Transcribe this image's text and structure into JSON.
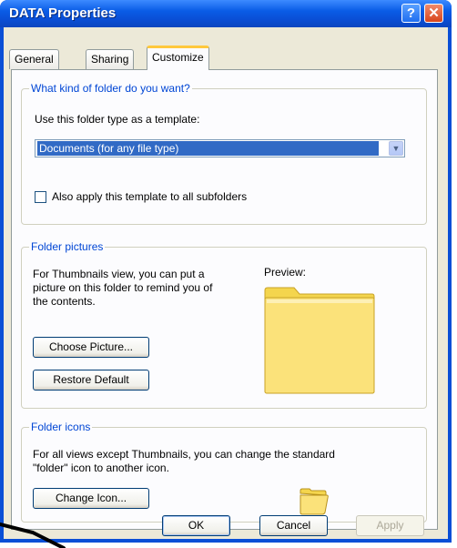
{
  "window": {
    "title": "DATA Properties"
  },
  "tabs": [
    {
      "label": "General"
    },
    {
      "label": "Sharing"
    },
    {
      "label": "Customize"
    }
  ],
  "folder_type": {
    "legend": "What kind of folder do you want?",
    "template_label": "Use this folder type as a template:",
    "selected": "Documents (for any file type)",
    "subfolders_label": "Also apply this template to all subfolders",
    "subfolders_checked": false
  },
  "folder_pictures": {
    "legend": "Folder pictures",
    "description_lines": [
      "For Thumbnails view, you can put a",
      "picture on this folder to remind you of",
      "the contents."
    ],
    "preview_label": "Preview:",
    "choose_button": "Choose Picture...",
    "restore_button": "Restore Default"
  },
  "folder_icons": {
    "legend": "Folder icons",
    "description_lines": [
      "For all views except Thumbnails, you can change the standard",
      "\"folder\" icon to another icon."
    ],
    "change_button": "Change Icon..."
  },
  "buttons": {
    "ok": "OK",
    "cancel": "Cancel",
    "apply": "Apply"
  },
  "colors": {
    "title_bar": "#0a4fd6",
    "legend_text": "#0046d5",
    "selection": "#316ac5",
    "folder_yellow": "#fbe27a"
  }
}
